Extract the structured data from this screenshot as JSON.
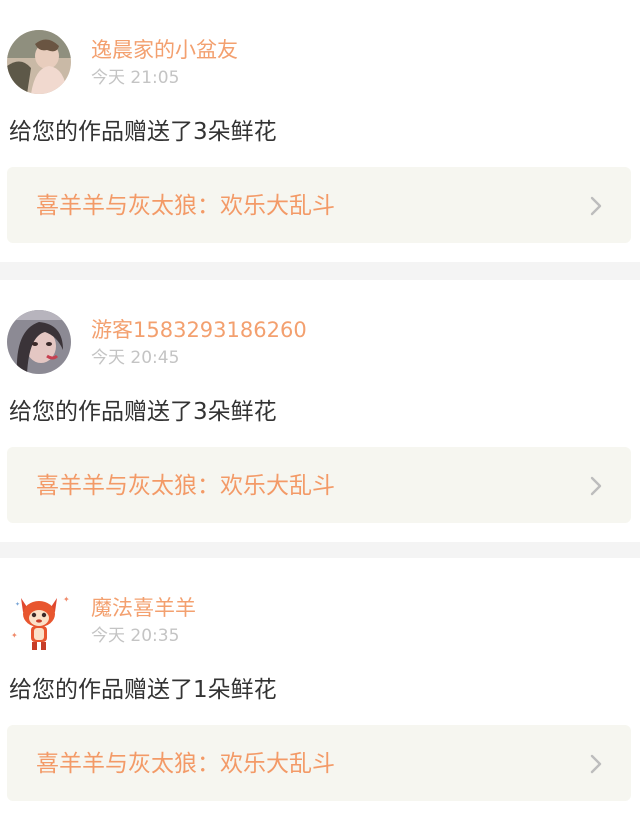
{
  "colors": {
    "accent": "#f3a06f",
    "page_background": "#f4f4f4",
    "card_background": "#ffffff",
    "link_background": "#f6f6f0",
    "timestamp": "#c4c4c4",
    "body_text": "#333333"
  },
  "notifications": [
    {
      "user_name": "逸晨家的小盆友",
      "time": "今天 21:05",
      "message": "给您的作品赠送了3朵鲜花",
      "work_title": "喜羊羊与灰太狼：欢乐大乱斗",
      "icon": "chevron-right-icon"
    },
    {
      "user_name": "游客1583293186260",
      "time": "今天 20:45",
      "message": "给您的作品赠送了3朵鲜花",
      "work_title": "喜羊羊与灰太狼：欢乐大乱斗",
      "icon": "chevron-right-icon"
    },
    {
      "user_name": "魔法喜羊羊",
      "time": "今天 20:35",
      "message": "给您的作品赠送了1朵鲜花",
      "work_title": "喜羊羊与灰太狼：欢乐大乱斗",
      "icon": "chevron-right-icon"
    }
  ]
}
